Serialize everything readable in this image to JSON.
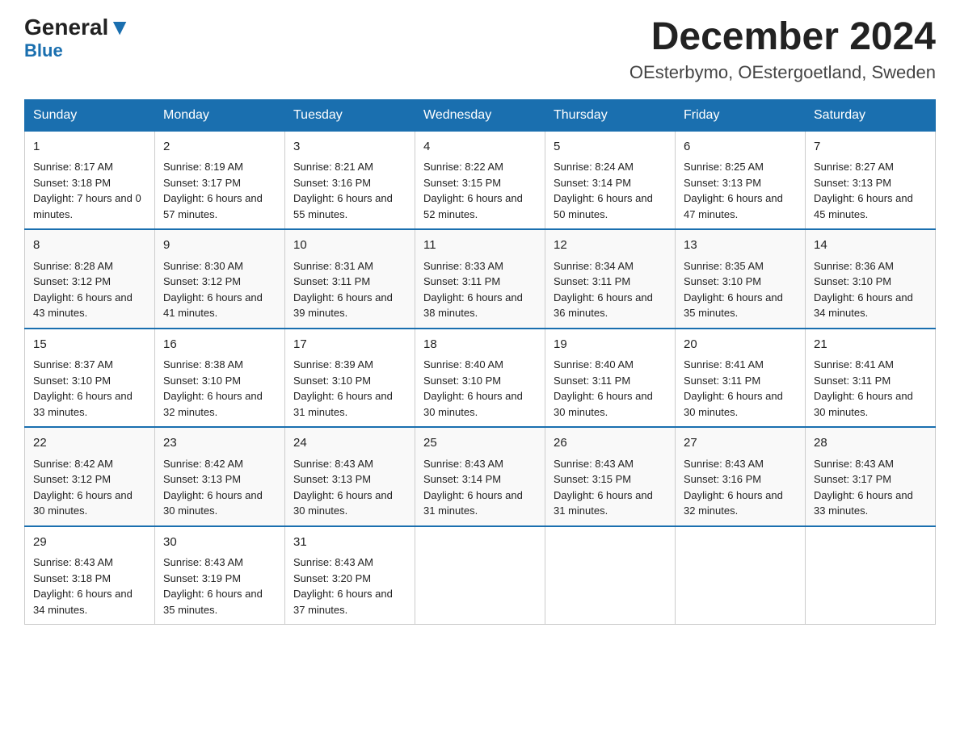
{
  "header": {
    "logo_general": "General",
    "logo_blue": "Blue",
    "month_title": "December 2024",
    "location": "OEsterbymo, OEstergoetland, Sweden"
  },
  "weekdays": [
    "Sunday",
    "Monday",
    "Tuesday",
    "Wednesday",
    "Thursday",
    "Friday",
    "Saturday"
  ],
  "weeks": [
    [
      {
        "day": "1",
        "sunrise": "8:17 AM",
        "sunset": "3:18 PM",
        "daylight": "7 hours and 0 minutes."
      },
      {
        "day": "2",
        "sunrise": "8:19 AM",
        "sunset": "3:17 PM",
        "daylight": "6 hours and 57 minutes."
      },
      {
        "day": "3",
        "sunrise": "8:21 AM",
        "sunset": "3:16 PM",
        "daylight": "6 hours and 55 minutes."
      },
      {
        "day": "4",
        "sunrise": "8:22 AM",
        "sunset": "3:15 PM",
        "daylight": "6 hours and 52 minutes."
      },
      {
        "day": "5",
        "sunrise": "8:24 AM",
        "sunset": "3:14 PM",
        "daylight": "6 hours and 50 minutes."
      },
      {
        "day": "6",
        "sunrise": "8:25 AM",
        "sunset": "3:13 PM",
        "daylight": "6 hours and 47 minutes."
      },
      {
        "day": "7",
        "sunrise": "8:27 AM",
        "sunset": "3:13 PM",
        "daylight": "6 hours and 45 minutes."
      }
    ],
    [
      {
        "day": "8",
        "sunrise": "8:28 AM",
        "sunset": "3:12 PM",
        "daylight": "6 hours and 43 minutes."
      },
      {
        "day": "9",
        "sunrise": "8:30 AM",
        "sunset": "3:12 PM",
        "daylight": "6 hours and 41 minutes."
      },
      {
        "day": "10",
        "sunrise": "8:31 AM",
        "sunset": "3:11 PM",
        "daylight": "6 hours and 39 minutes."
      },
      {
        "day": "11",
        "sunrise": "8:33 AM",
        "sunset": "3:11 PM",
        "daylight": "6 hours and 38 minutes."
      },
      {
        "day": "12",
        "sunrise": "8:34 AM",
        "sunset": "3:11 PM",
        "daylight": "6 hours and 36 minutes."
      },
      {
        "day": "13",
        "sunrise": "8:35 AM",
        "sunset": "3:10 PM",
        "daylight": "6 hours and 35 minutes."
      },
      {
        "day": "14",
        "sunrise": "8:36 AM",
        "sunset": "3:10 PM",
        "daylight": "6 hours and 34 minutes."
      }
    ],
    [
      {
        "day": "15",
        "sunrise": "8:37 AM",
        "sunset": "3:10 PM",
        "daylight": "6 hours and 33 minutes."
      },
      {
        "day": "16",
        "sunrise": "8:38 AM",
        "sunset": "3:10 PM",
        "daylight": "6 hours and 32 minutes."
      },
      {
        "day": "17",
        "sunrise": "8:39 AM",
        "sunset": "3:10 PM",
        "daylight": "6 hours and 31 minutes."
      },
      {
        "day": "18",
        "sunrise": "8:40 AM",
        "sunset": "3:10 PM",
        "daylight": "6 hours and 30 minutes."
      },
      {
        "day": "19",
        "sunrise": "8:40 AM",
        "sunset": "3:11 PM",
        "daylight": "6 hours and 30 minutes."
      },
      {
        "day": "20",
        "sunrise": "8:41 AM",
        "sunset": "3:11 PM",
        "daylight": "6 hours and 30 minutes."
      },
      {
        "day": "21",
        "sunrise": "8:41 AM",
        "sunset": "3:11 PM",
        "daylight": "6 hours and 30 minutes."
      }
    ],
    [
      {
        "day": "22",
        "sunrise": "8:42 AM",
        "sunset": "3:12 PM",
        "daylight": "6 hours and 30 minutes."
      },
      {
        "day": "23",
        "sunrise": "8:42 AM",
        "sunset": "3:13 PM",
        "daylight": "6 hours and 30 minutes."
      },
      {
        "day": "24",
        "sunrise": "8:43 AM",
        "sunset": "3:13 PM",
        "daylight": "6 hours and 30 minutes."
      },
      {
        "day": "25",
        "sunrise": "8:43 AM",
        "sunset": "3:14 PM",
        "daylight": "6 hours and 31 minutes."
      },
      {
        "day": "26",
        "sunrise": "8:43 AM",
        "sunset": "3:15 PM",
        "daylight": "6 hours and 31 minutes."
      },
      {
        "day": "27",
        "sunrise": "8:43 AM",
        "sunset": "3:16 PM",
        "daylight": "6 hours and 32 minutes."
      },
      {
        "day": "28",
        "sunrise": "8:43 AM",
        "sunset": "3:17 PM",
        "daylight": "6 hours and 33 minutes."
      }
    ],
    [
      {
        "day": "29",
        "sunrise": "8:43 AM",
        "sunset": "3:18 PM",
        "daylight": "6 hours and 34 minutes."
      },
      {
        "day": "30",
        "sunrise": "8:43 AM",
        "sunset": "3:19 PM",
        "daylight": "6 hours and 35 minutes."
      },
      {
        "day": "31",
        "sunrise": "8:43 AM",
        "sunset": "3:20 PM",
        "daylight": "6 hours and 37 minutes."
      },
      {
        "day": "",
        "sunrise": "",
        "sunset": "",
        "daylight": ""
      },
      {
        "day": "",
        "sunrise": "",
        "sunset": "",
        "daylight": ""
      },
      {
        "day": "",
        "sunrise": "",
        "sunset": "",
        "daylight": ""
      },
      {
        "day": "",
        "sunrise": "",
        "sunset": "",
        "daylight": ""
      }
    ]
  ],
  "labels": {
    "sunrise": "Sunrise:",
    "sunset": "Sunset:",
    "daylight": "Daylight:"
  }
}
